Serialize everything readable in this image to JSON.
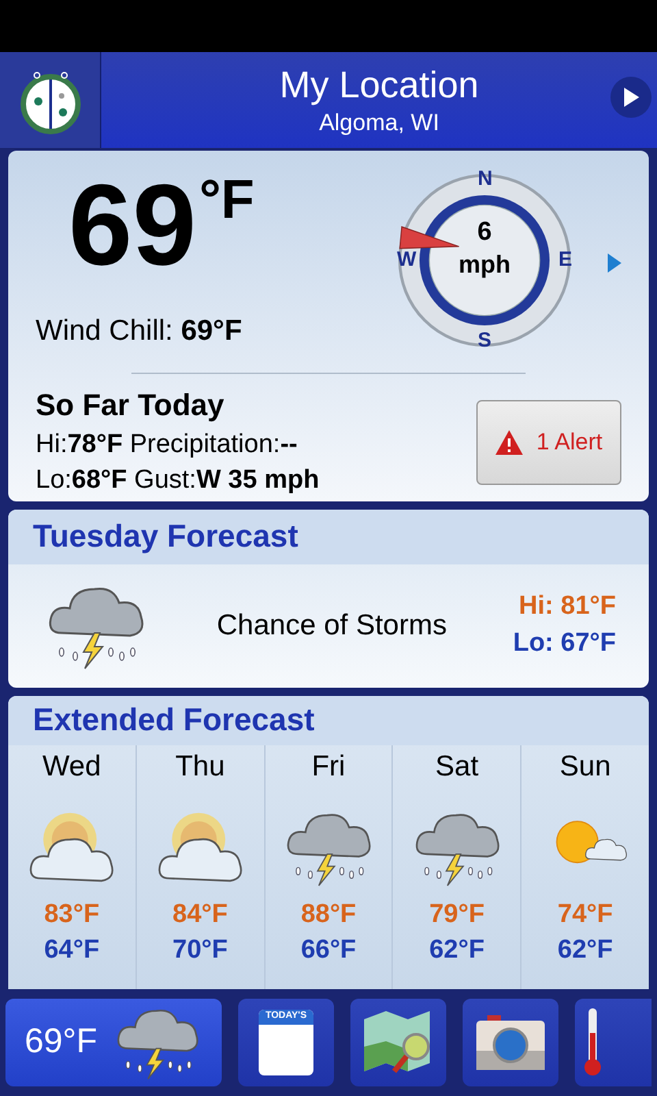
{
  "header": {
    "title": "My Location",
    "subtitle": "Algoma, WI"
  },
  "current": {
    "temperature": "69",
    "unit": "°F",
    "wind_chill_label": "Wind Chill:",
    "wind_chill": "69°F",
    "wind": {
      "speed": "6",
      "unit": "mph",
      "points": [
        "N",
        "E",
        "S",
        "W"
      ]
    },
    "today_title": "So Far Today",
    "hi_label": "Hi:",
    "hi": "78°F",
    "precip_label": "Precipitation:",
    "precip": "--",
    "lo_label": "Lo:",
    "lo": "68°F",
    "gust_label": "Gust:",
    "gust": "W 35 mph",
    "alert": "1 Alert"
  },
  "tuesday": {
    "title": "Tuesday Forecast",
    "condition": "Chance of Storms",
    "kind": "storm",
    "hi": "Hi: 81°F",
    "lo": "Lo: 67°F"
  },
  "extended": {
    "title": "Extended Forecast",
    "days": [
      {
        "day": "Wed",
        "kind": "partly",
        "hi": "83°F",
        "lo": "64°F"
      },
      {
        "day": "Thu",
        "kind": "partly",
        "hi": "84°F",
        "lo": "70°F"
      },
      {
        "day": "Fri",
        "kind": "storm",
        "hi": "88°F",
        "lo": "66°F"
      },
      {
        "day": "Sat",
        "kind": "storm",
        "hi": "79°F",
        "lo": "62°F"
      },
      {
        "day": "Sun",
        "kind": "sunny",
        "hi": "74°F",
        "lo": "62°F"
      }
    ]
  },
  "bottom_bar": {
    "temperature": "69°F",
    "kind": "storm",
    "calendar_label": "TODAY'S"
  }
}
